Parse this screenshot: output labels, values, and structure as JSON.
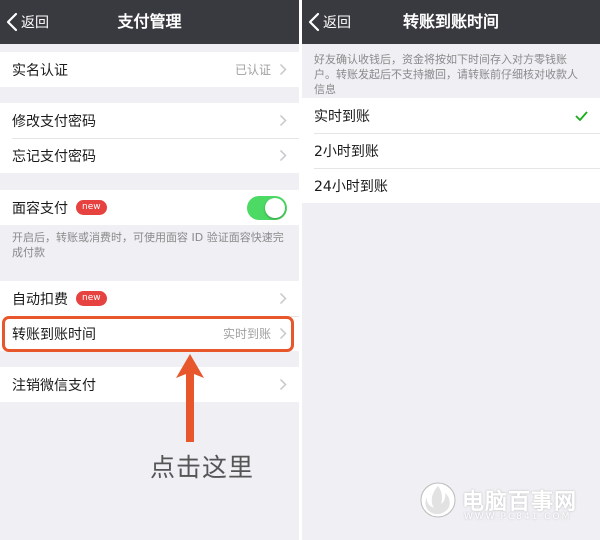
{
  "colors": {
    "navbar": "#393a3f",
    "highlight": "#e8562b",
    "toggle_on": "#4cd964",
    "badge": "#e64340",
    "check": "#1aad19"
  },
  "left": {
    "nav": {
      "back_label": "返回",
      "title": "支付管理"
    },
    "real_name": {
      "label": "实名认证",
      "value": "已认证"
    },
    "change_pwd": {
      "label": "修改支付密码"
    },
    "forgot_pwd": {
      "label": "忘记支付密码"
    },
    "face_pay": {
      "label": "面容支付",
      "badge": "new",
      "toggle_on": true
    },
    "face_hint": "开启后，转账或消费时，可使用面容 ID 验证面容快速完成付款",
    "auto_deduct": {
      "label": "自动扣费",
      "badge": "new"
    },
    "transfer_time": {
      "label": "转账到账时间",
      "value": "实时到账"
    },
    "cancel_pay": {
      "label": "注销微信支付"
    },
    "annotation": "点击这里"
  },
  "right": {
    "nav": {
      "back_label": "返回",
      "title": "转账到账时间"
    },
    "info": "好友确认收钱后，资金将按如下时间存入对方零钱账户。转账发起后不支持撤回，请转账前仔细核对收款人信息",
    "options": [
      {
        "label": "实时到账",
        "selected": true
      },
      {
        "label": "2小时到账",
        "selected": false
      },
      {
        "label": "24小时到账",
        "selected": false
      }
    ]
  },
  "watermark": {
    "text": "电脑百事网",
    "url": "WWW.PC841.COM"
  }
}
